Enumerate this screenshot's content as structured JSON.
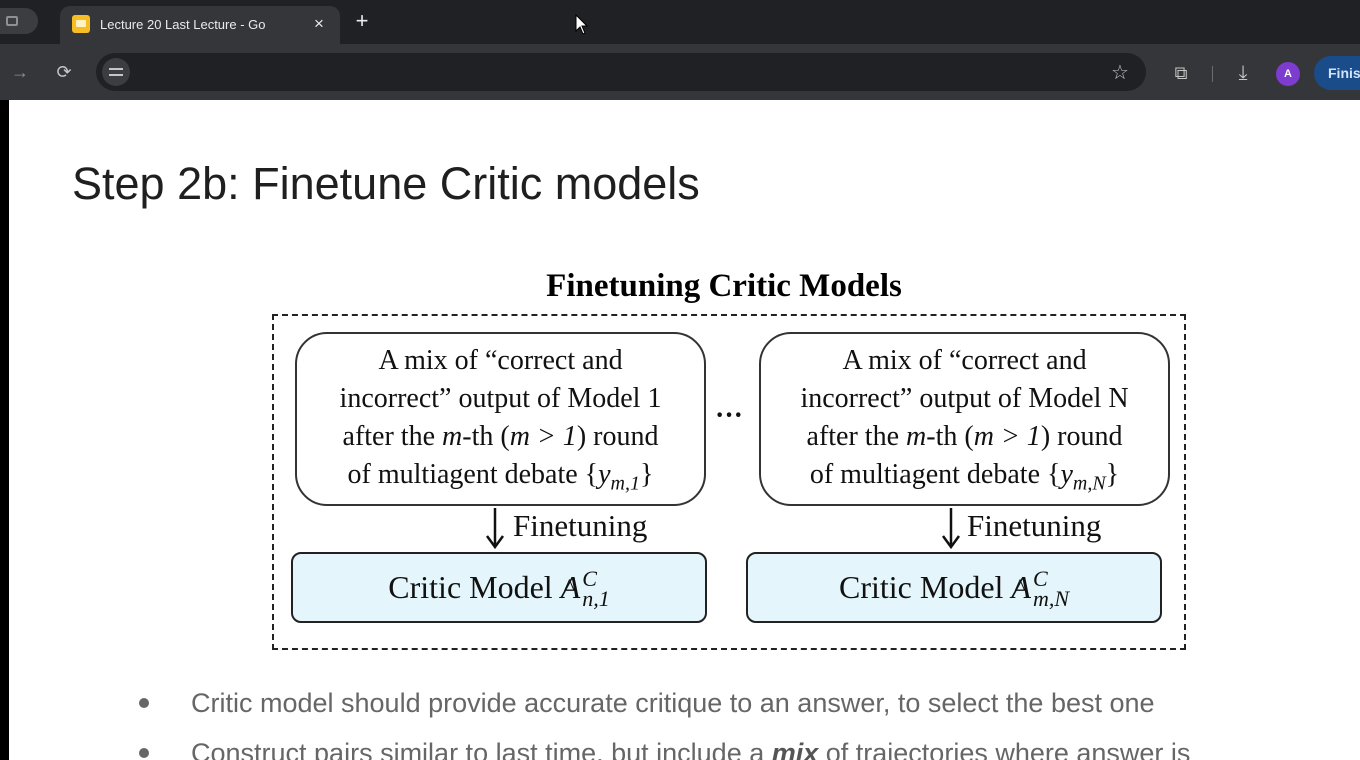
{
  "browser": {
    "active_tab_title": "Lecture 20 Last Lecture - Go",
    "tab_close": "×",
    "new_tab": "+",
    "nav_forward": "→",
    "nav_reload": "⟳",
    "bookmark": "☆",
    "extensions": "⧉",
    "download": "⤓",
    "profile_initial": "A",
    "finish_label": "Finis"
  },
  "slide": {
    "title": "Step 2b: Finetune Critic models",
    "figure": {
      "title": "Finetuning Critic Models",
      "left_box": {
        "line1": "A mix of “correct and",
        "line2": "incorrect” output of Model 1",
        "line3_pre": "after the ",
        "line3_m": "m",
        "line3_mid": "-th (",
        "line3_cond": "m > 1",
        "line3_post": ") round",
        "line4_pre": "of multiagent debate {",
        "line4_var": "y",
        "line4_sub": "m,1",
        "line4_post": "}"
      },
      "right_box": {
        "line1": "A mix of “correct and",
        "line2": "incorrect” output of Model N",
        "line3_pre": "after the ",
        "line3_m": "m",
        "line3_mid": "-th (",
        "line3_cond": "m > 1",
        "line3_post": ") round",
        "line4_pre": "of multiagent debate {",
        "line4_var": "y",
        "line4_sub": "m,N",
        "line4_post": "}"
      },
      "ellipsis": "···",
      "finetuning_label": "Finetuning",
      "critic_left": {
        "prefix": "Critic Model ",
        "symbol": "A",
        "hat": "^",
        "sup": "C",
        "sub": "n,1"
      },
      "critic_right": {
        "prefix": "Critic Model ",
        "symbol": "A",
        "hat": "^",
        "sup": "C",
        "sub": "m,N"
      }
    },
    "bullets": {
      "b1": "Critic model should provide accurate critique to an answer, to select the best one",
      "b2_pre": "Construct pairs similar to last time, but include a ",
      "b2_em": "mix",
      "b2_post": " of trajectories where answer is"
    }
  }
}
